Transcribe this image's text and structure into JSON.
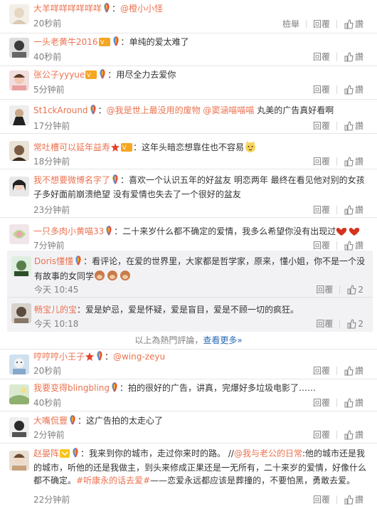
{
  "rows": [
    {
      "user": "大羊咩咩咩咩咩咩",
      "sep": "：",
      "text": "@橙小小怪",
      "time": "20秒前",
      "report": "檢舉",
      "reply": "回覆",
      "like": "讚"
    },
    {
      "user": "一头老黄牛2016",
      "sep": "：",
      "text": "单纯的爱太难了",
      "time": "40秒前",
      "reply": "回覆",
      "like": "讚"
    },
    {
      "user": "张公子yyyue",
      "sep": "：",
      "text": "用尽全力去爱你",
      "time": "5分钟前",
      "reply": "回覆",
      "like": "讚"
    },
    {
      "user": "St1ckAround",
      "sep": "：",
      "mention1": "@我是世上最没用的废物",
      "mention2": "@窦涵喵喵喵",
      "text": " 丸美的广告真好看啊",
      "time": "17分钟前",
      "reply": "回覆",
      "like": "讚"
    },
    {
      "user": "常吐槽可以延年益寿",
      "sep": "：",
      "text": "这年头暗恋想靠住也不容易",
      "time": "18分钟前",
      "reply": "回覆",
      "like": "讚"
    },
    {
      "user": "我不想要微博名字了",
      "sep": "：",
      "text": "喜欢一个认识五年的好盆友 明恋两年 最终在看见他对别的女孩子多好面前崩溃绝望 没有爱情也失去了一个很好的盆友",
      "time": "23分钟前",
      "reply": "回覆",
      "like": "讚"
    },
    {
      "user": "一只多肉小黄喵33",
      "sep": "：",
      "text": "二十来岁什么都不确定的爱情，我多么希望你没有出现过",
      "time": "7分钟前",
      "reply": "回覆",
      "like": "讚"
    }
  ],
  "subs": [
    {
      "user": "Doris懂懂",
      "sep": "：",
      "text": "看评论，在爱的世界里，大家都是哲学家，原来，懂小姐，你不是一个没有故事的女同学",
      "time": "今天 10:45",
      "reply": "回覆",
      "like": "2"
    },
    {
      "user": "畅宝儿的宝",
      "sep": "：",
      "text": "爱是妒忌，爱是怀疑，爱是盲目，爱是不顾一切的疯狂。",
      "time": "今天 10:18",
      "reply": "回覆",
      "like": "2"
    }
  ],
  "banner": {
    "text": "以上為熱門評論，",
    "more": "查看更多»"
  },
  "rows2": [
    {
      "user": "哼哼哼小王子",
      "sep": "：",
      "text": "@wing-zeyu",
      "time": "20秒前",
      "reply": "回覆",
      "like": "讚"
    },
    {
      "user": "我要变得blingbling",
      "sep": "：",
      "text": "拍的很好的广告，讲真，完爆好多垃圾电影了……",
      "time": "40秒前",
      "reply": "回覆",
      "like": "讚"
    },
    {
      "user": "大嘴侃豐",
      "sep": "：",
      "text": "这广告拍的太走心了",
      "time": "2分钟前",
      "reply": "回覆",
      "like": "讚"
    },
    {
      "user": "赵晏阵",
      "sep": "：",
      "text_a": "我来到你的城市，走过你来时的路。 //",
      "mention": "@我与老公的日常",
      "text_b": ":他的城市还是我的城市，听他的还是我做主，到头来修成正果还是一无所有，二十来岁的爱情，好像什么都不确定。",
      "topic": "#听康永的话去爱#",
      "text_c": "——恋爱永远都应该是葬撞的，不要怕黑，勇敢去爱。",
      "time": "22分钟前",
      "reply": "回覆",
      "like": "讚"
    }
  ]
}
